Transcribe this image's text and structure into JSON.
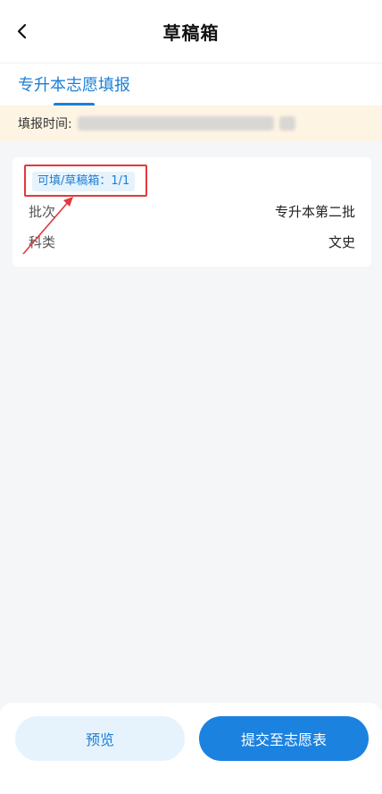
{
  "header": {
    "title": "草稿箱",
    "back_icon": "chevron-left-icon"
  },
  "tabs": [
    {
      "label": "专升本志愿填报",
      "active": true
    }
  ],
  "fill_time": {
    "label": "填报时间:"
  },
  "card": {
    "badge": "可填/草稿箱：1/1",
    "rows": [
      {
        "label": "批次",
        "value": "专升本第二批"
      },
      {
        "label": "科类",
        "value": "文史"
      }
    ]
  },
  "footer": {
    "preview_label": "预览",
    "submit_label": "提交至志愿表"
  },
  "colors": {
    "accent": "#1b7fd6",
    "annotation": "#e0393e",
    "time_bar_bg": "#fdf4e3"
  }
}
